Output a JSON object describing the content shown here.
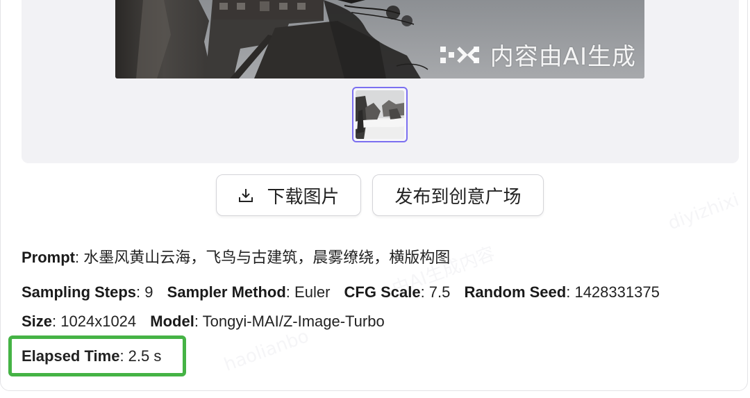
{
  "image_watermark": {
    "text": "内容由AI生成",
    "icon": "ai-logo-icon"
  },
  "background_watermarks": [
    "diyizhixi",
    "haolianbo",
    "由AI生成内容"
  ],
  "actions": {
    "download_label": "下载图片",
    "download_icon": "download-icon",
    "publish_label": "发布到创意广场"
  },
  "details": {
    "prompt_label": "Prompt",
    "prompt_value": "水墨风黄山云海，飞鸟与古建筑，晨雾缭绕，横版构图",
    "steps_label": "Sampling Steps",
    "steps_value": "9",
    "sampler_label": "Sampler Method",
    "sampler_value": "Euler",
    "cfg_label": "CFG Scale",
    "cfg_value": "7.5",
    "seed_label": "Random Seed",
    "seed_value": "1428331375",
    "size_label": "Size",
    "size_value": "1024x1024",
    "model_label": "Model",
    "model_value": "Tongyi-MAI/Z-Image-Turbo",
    "elapsed_label": "Elapsed Time",
    "elapsed_value": "2.5 s"
  },
  "colors": {
    "highlight_border": "#45b345",
    "thumb_border": "#7b6ff0",
    "panel_bg": "#f2f2f5"
  }
}
